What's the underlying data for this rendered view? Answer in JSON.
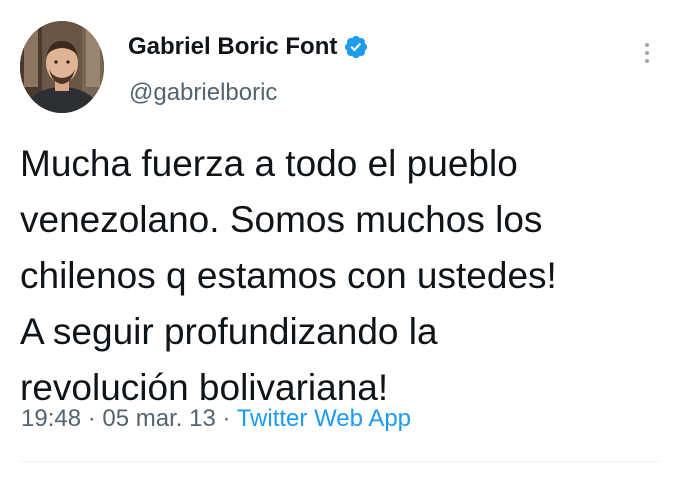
{
  "author": {
    "name": "Gabriel Boric Font",
    "handle": "@gabrielboric",
    "verified": true,
    "avatar_icon": "profile-photo"
  },
  "tweet": {
    "lines": [
      "Mucha fuerza a todo el pueblo",
      "venezolano. Somos muchos los",
      "chilenos q estamos con ustedes!",
      "A seguir profundizando la",
      "revolución bolivariana!"
    ],
    "time": "19:48",
    "separator": "·",
    "date": "05 mar. 13",
    "source": "Twitter Web App"
  },
  "colors": {
    "accent": "#1d9bf0",
    "text": "#0f1419",
    "secondary": "#536471"
  },
  "icons": {
    "verified": "verified-badge-icon",
    "more": "more-options-icon"
  }
}
